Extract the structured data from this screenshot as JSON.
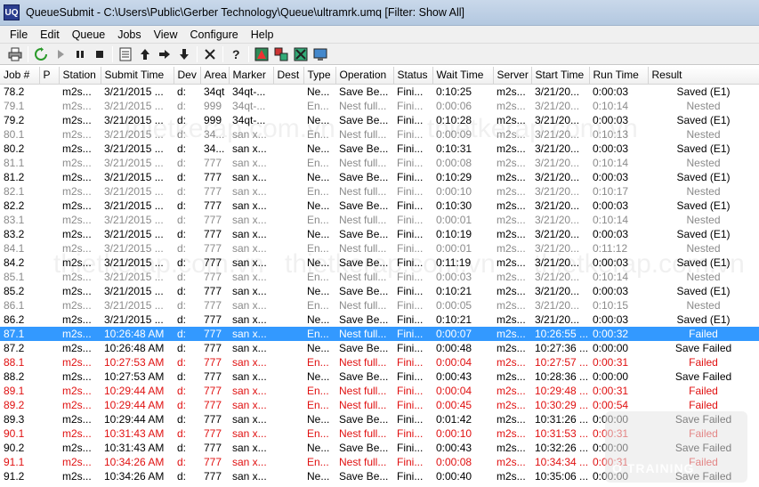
{
  "window": {
    "title": "QueueSubmit - C:\\Users\\Public\\Gerber Technology\\Queue\\ultramrk.umq    [Filter: Show All]",
    "icon_text": "UQ"
  },
  "menu": [
    "File",
    "Edit",
    "Queue",
    "Jobs",
    "View",
    "Configure",
    "Help"
  ],
  "toolbar": {
    "icons": [
      "print-icon",
      "refresh-icon",
      "play-icon",
      "pause-icon",
      "stop-icon",
      "list-icon",
      "arrow-up-icon",
      "arrow-right-icon",
      "arrow-down-icon",
      "delete-icon",
      "help-icon",
      "marker-view-icon",
      "layout-icon",
      "nest-icon",
      "monitor-icon"
    ]
  },
  "columns": [
    "Job #",
    "P",
    "Station",
    "Submit Time",
    "Dev",
    "Area",
    "Marker",
    "Dest",
    "Type",
    "Operation",
    "Status",
    "Wait Time",
    "Server",
    "Start Time",
    "Run Time",
    "Result"
  ],
  "rows": [
    {
      "style": "normal",
      "cells": [
        "78.2",
        "",
        "m2s...",
        "3/21/2015 ...",
        "d:",
        "34qt",
        "34qt-...",
        "",
        "Ne...",
        "Save Be...",
        "Fini...",
        "0:10:25",
        "m2s...",
        "3/21/20...",
        "0:00:03",
        "Saved (E1)"
      ]
    },
    {
      "style": "gray",
      "cells": [
        "79.1",
        "",
        "m2s...",
        "3/21/2015 ...",
        "d:",
        "999",
        "34qt-...",
        "",
        "En...",
        "Nest full...",
        "Fini...",
        "0:00:06",
        "m2s...",
        "3/21/20...",
        "0:10:14",
        "Nested"
      ]
    },
    {
      "style": "normal",
      "cells": [
        "79.2",
        "",
        "m2s...",
        "3/21/2015 ...",
        "d:",
        "999",
        "34qt-...",
        "",
        "Ne...",
        "Save Be...",
        "Fini...",
        "0:10:28",
        "m2s...",
        "3/21/20...",
        "0:00:03",
        "Saved (E1)"
      ]
    },
    {
      "style": "gray",
      "cells": [
        "80.1",
        "",
        "m2s...",
        "3/21/2015 ...",
        "d:",
        "34...",
        "san x...",
        "",
        "En...",
        "Nest full...",
        "Fini...",
        "0:00:09",
        "m2s...",
        "3/21/20...",
        "0:10:13",
        "Nested"
      ]
    },
    {
      "style": "normal",
      "cells": [
        "80.2",
        "",
        "m2s...",
        "3/21/2015 ...",
        "d:",
        "34...",
        "san x...",
        "",
        "Ne...",
        "Save Be...",
        "Fini...",
        "0:10:31",
        "m2s...",
        "3/21/20...",
        "0:00:03",
        "Saved (E1)"
      ]
    },
    {
      "style": "gray",
      "cells": [
        "81.1",
        "",
        "m2s...",
        "3/21/2015 ...",
        "d:",
        "777",
        "san x...",
        "",
        "En...",
        "Nest full...",
        "Fini...",
        "0:00:08",
        "m2s...",
        "3/21/20...",
        "0:10:14",
        "Nested"
      ]
    },
    {
      "style": "normal",
      "cells": [
        "81.2",
        "",
        "m2s...",
        "3/21/2015 ...",
        "d:",
        "777",
        "san x...",
        "",
        "Ne...",
        "Save Be...",
        "Fini...",
        "0:10:29",
        "m2s...",
        "3/21/20...",
        "0:00:03",
        "Saved (E1)"
      ]
    },
    {
      "style": "gray",
      "cells": [
        "82.1",
        "",
        "m2s...",
        "3/21/2015 ...",
        "d:",
        "777",
        "san x...",
        "",
        "En...",
        "Nest full...",
        "Fini...",
        "0:00:10",
        "m2s...",
        "3/21/20...",
        "0:10:17",
        "Nested"
      ]
    },
    {
      "style": "normal",
      "cells": [
        "82.2",
        "",
        "m2s...",
        "3/21/2015 ...",
        "d:",
        "777",
        "san x...",
        "",
        "Ne...",
        "Save Be...",
        "Fini...",
        "0:10:30",
        "m2s...",
        "3/21/20...",
        "0:00:03",
        "Saved (E1)"
      ]
    },
    {
      "style": "gray",
      "cells": [
        "83.1",
        "",
        "m2s...",
        "3/21/2015 ...",
        "d:",
        "777",
        "san x...",
        "",
        "En...",
        "Nest full...",
        "Fini...",
        "0:00:01",
        "m2s...",
        "3/21/20...",
        "0:10:14",
        "Nested"
      ]
    },
    {
      "style": "normal",
      "cells": [
        "83.2",
        "",
        "m2s...",
        "3/21/2015 ...",
        "d:",
        "777",
        "san x...",
        "",
        "Ne...",
        "Save Be...",
        "Fini...",
        "0:10:19",
        "m2s...",
        "3/21/20...",
        "0:00:03",
        "Saved (E1)"
      ]
    },
    {
      "style": "gray",
      "cells": [
        "84.1",
        "",
        "m2s...",
        "3/21/2015 ...",
        "d:",
        "777",
        "san x...",
        "",
        "En...",
        "Nest full...",
        "Fini...",
        "0:00:01",
        "m2s...",
        "3/21/20...",
        "0:11:12",
        "Nested"
      ]
    },
    {
      "style": "normal",
      "cells": [
        "84.2",
        "",
        "m2s...",
        "3/21/2015 ...",
        "d:",
        "777",
        "san x...",
        "",
        "Ne...",
        "Save Be...",
        "Fini...",
        "0:11:19",
        "m2s...",
        "3/21/20...",
        "0:00:03",
        "Saved (E1)"
      ]
    },
    {
      "style": "gray",
      "cells": [
        "85.1",
        "",
        "m2s...",
        "3/21/2015 ...",
        "d:",
        "777",
        "san x...",
        "",
        "En...",
        "Nest full...",
        "Fini...",
        "0:00:03",
        "m2s...",
        "3/21/20...",
        "0:10:14",
        "Nested"
      ]
    },
    {
      "style": "normal",
      "cells": [
        "85.2",
        "",
        "m2s...",
        "3/21/2015 ...",
        "d:",
        "777",
        "san x...",
        "",
        "Ne...",
        "Save Be...",
        "Fini...",
        "0:10:21",
        "m2s...",
        "3/21/20...",
        "0:00:03",
        "Saved (E1)"
      ]
    },
    {
      "style": "gray",
      "cells": [
        "86.1",
        "",
        "m2s...",
        "3/21/2015 ...",
        "d:",
        "777",
        "san x...",
        "",
        "En...",
        "Nest full...",
        "Fini...",
        "0:00:05",
        "m2s...",
        "3/21/20...",
        "0:10:15",
        "Nested"
      ]
    },
    {
      "style": "normal",
      "cells": [
        "86.2",
        "",
        "m2s...",
        "3/21/2015 ...",
        "d:",
        "777",
        "san x...",
        "",
        "Ne...",
        "Save Be...",
        "Fini...",
        "0:10:21",
        "m2s...",
        "3/21/20...",
        "0:00:03",
        "Saved (E1)"
      ]
    },
    {
      "style": "selected",
      "cells": [
        "87.1",
        "",
        "m2s...",
        "10:26:48 AM",
        "d:",
        "777",
        "san x...",
        "",
        "En...",
        "Nest full...",
        "Fini...",
        "0:00:07",
        "m2s...",
        "10:26:55 ...",
        "0:00:32",
        "Failed"
      ]
    },
    {
      "style": "normal",
      "cells": [
        "87.2",
        "",
        "m2s...",
        "10:26:48 AM",
        "d:",
        "777",
        "san x...",
        "",
        "Ne...",
        "Save Be...",
        "Fini...",
        "0:00:48",
        "m2s...",
        "10:27:36 ...",
        "0:00:00",
        "Save Failed"
      ]
    },
    {
      "style": "red",
      "cells": [
        "88.1",
        "",
        "m2s...",
        "10:27:53 AM",
        "d:",
        "777",
        "san x...",
        "",
        "En...",
        "Nest full...",
        "Fini...",
        "0:00:04",
        "m2s...",
        "10:27:57 ...",
        "0:00:31",
        "Failed"
      ]
    },
    {
      "style": "normal",
      "cells": [
        "88.2",
        "",
        "m2s...",
        "10:27:53 AM",
        "d:",
        "777",
        "san x...",
        "",
        "Ne...",
        "Save Be...",
        "Fini...",
        "0:00:43",
        "m2s...",
        "10:28:36 ...",
        "0:00:00",
        "Save Failed"
      ]
    },
    {
      "style": "red",
      "cells": [
        "89.1",
        "",
        "m2s...",
        "10:29:44 AM",
        "d:",
        "777",
        "san x...",
        "",
        "En...",
        "Nest full...",
        "Fini...",
        "0:00:04",
        "m2s...",
        "10:29:48 ...",
        "0:00:31",
        "Failed"
      ]
    },
    {
      "style": "red",
      "cells": [
        "89.2",
        "",
        "m2s...",
        "10:29:44 AM",
        "d:",
        "777",
        "san x...",
        "",
        "En...",
        "Nest full...",
        "Fini...",
        "0:00:45",
        "m2s...",
        "10:30:29 ...",
        "0:00:54",
        "Failed"
      ]
    },
    {
      "style": "normal",
      "cells": [
        "89.3",
        "",
        "m2s...",
        "10:29:44 AM",
        "d:",
        "777",
        "san x...",
        "",
        "Ne...",
        "Save Be...",
        "Fini...",
        "0:01:42",
        "m2s...",
        "10:31:26 ...",
        "0:00:00",
        "Save Failed"
      ]
    },
    {
      "style": "red",
      "cells": [
        "90.1",
        "",
        "m2s...",
        "10:31:43 AM",
        "d:",
        "777",
        "san x...",
        "",
        "En...",
        "Nest full...",
        "Fini...",
        "0:00:10",
        "m2s...",
        "10:31:53 ...",
        "0:00:31",
        "Failed"
      ]
    },
    {
      "style": "normal",
      "cells": [
        "90.2",
        "",
        "m2s...",
        "10:31:43 AM",
        "d:",
        "777",
        "san x...",
        "",
        "Ne...",
        "Save Be...",
        "Fini...",
        "0:00:43",
        "m2s...",
        "10:32:26 ...",
        "0:00:00",
        "Save Failed"
      ]
    },
    {
      "style": "red",
      "cells": [
        "91.1",
        "",
        "m2s...",
        "10:34:26 AM",
        "d:",
        "777",
        "san x...",
        "",
        "En...",
        "Nest full...",
        "Fini...",
        "0:00:08",
        "m2s...",
        "10:34:34 ...",
        "0:00:31",
        "Failed"
      ]
    },
    {
      "style": "normal",
      "cells": [
        "91.2",
        "",
        "m2s...",
        "10:34:26 AM",
        "d:",
        "777",
        "san x...",
        "",
        "Ne...",
        "Save Be...",
        "Fini...",
        "0:00:40",
        "m2s...",
        "10:35:06 ...",
        "0:00:00",
        "Save Failed"
      ]
    }
  ],
  "watermark": {
    "text": "thietkerap.com.vn",
    "badge_text": "O TRAINING"
  }
}
